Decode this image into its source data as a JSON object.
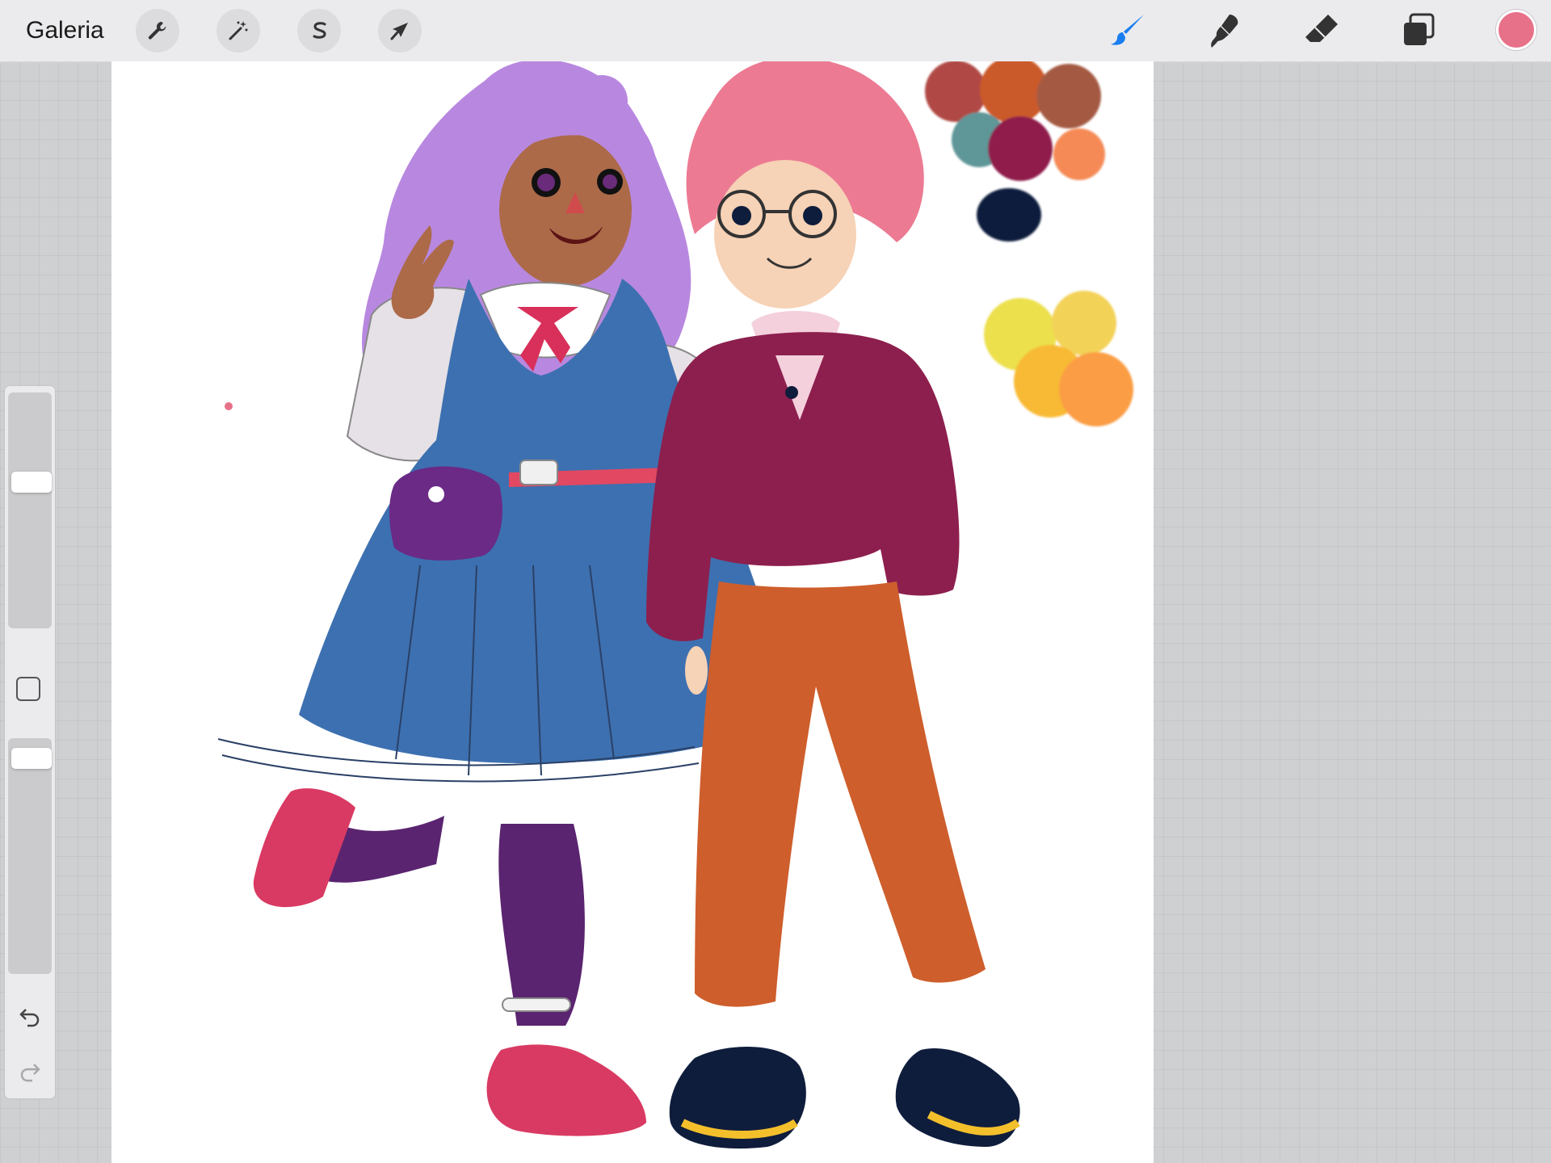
{
  "app": {
    "gallery_label": "Galeria"
  },
  "toolbar": {
    "left_tools": [
      "wrench-icon",
      "magic-wand-icon",
      "selection-s-icon",
      "transform-arrow-icon"
    ],
    "right_tools": [
      "brush-icon",
      "smudge-icon",
      "eraser-icon",
      "layers-icon"
    ],
    "active_tool": "brush",
    "active_tool_color": "#1a7ef0",
    "current_color": "#e8718a"
  },
  "sidebar": {
    "brush_size_level": 0.25,
    "opacity_level": 0.05,
    "undo_icon": "undo-icon",
    "redo_icon": "redo-icon"
  },
  "canvas": {
    "palette_colors": [
      "#b04a44",
      "#cb5a2a",
      "#a45a42",
      "#5e9698",
      "#8f1f4c",
      "#f58a56",
      "#0f1d3c",
      "#ede04e",
      "#f3d258",
      "#f8ba36",
      "#fb9d45"
    ]
  }
}
